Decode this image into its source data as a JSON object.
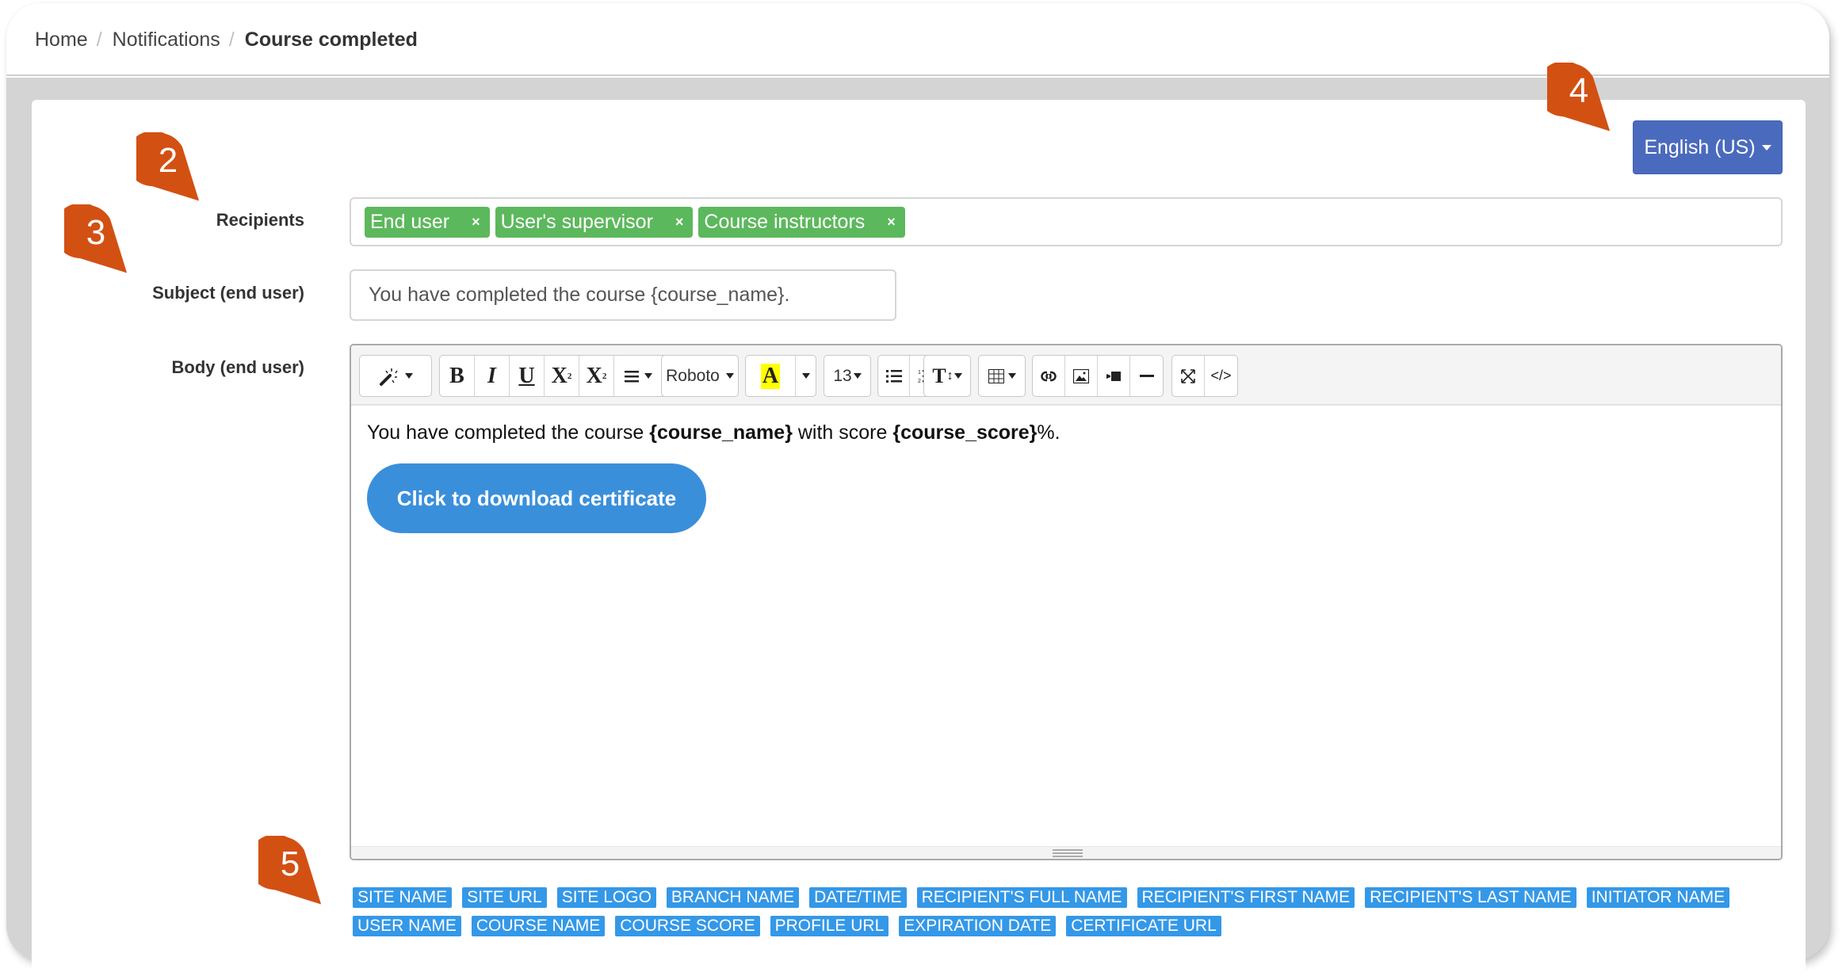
{
  "breadcrumb": {
    "items": [
      "Home",
      "Notifications"
    ],
    "current": "Course completed",
    "separator": "/"
  },
  "language": {
    "selected": "English (US)"
  },
  "form": {
    "recipients_label": "Recipients",
    "recipients": [
      {
        "label": "End user",
        "remove": "×"
      },
      {
        "label": "User's supervisor",
        "remove": "×"
      },
      {
        "label": "Course instructors",
        "remove": "×"
      }
    ],
    "subject_label": "Subject (end user)",
    "subject_value": "You have completed the course {course_name}.",
    "body_label": "Body (end user)"
  },
  "toolbar": {
    "font_name": "Roboto",
    "font_size": "13",
    "bold": "B",
    "italic": "I",
    "underline": "U",
    "superscript": "X",
    "subscript": "X",
    "color": "A",
    "line_height": "T",
    "codeview": "</>"
  },
  "body": {
    "text_prefix": "You have completed the course ",
    "var_course_name": "{course_name}",
    "text_mid": " with score ",
    "var_course_score": "{course_score}",
    "text_suffix": "%.",
    "button_label": "Click to download certificate"
  },
  "variables": [
    "SITE NAME",
    "SITE URL",
    "SITE LOGO",
    "BRANCH NAME",
    "DATE/TIME",
    "RECIPIENT'S FULL NAME",
    "RECIPIENT'S FIRST NAME",
    "RECIPIENT'S LAST NAME",
    "INITIATOR NAME",
    "USER NAME",
    "COURSE NAME",
    "COURSE SCORE",
    "PROFILE URL",
    "EXPIRATION DATE",
    "CERTIFICATE URL"
  ],
  "markers": [
    "2",
    "3",
    "4",
    "5"
  ],
  "colors": {
    "marker": "#d35013",
    "language_button": "#4a6bbd",
    "chip": "#5cb85c",
    "variable_tag": "#3498e8",
    "certificate_button": "#3a8fdb"
  }
}
